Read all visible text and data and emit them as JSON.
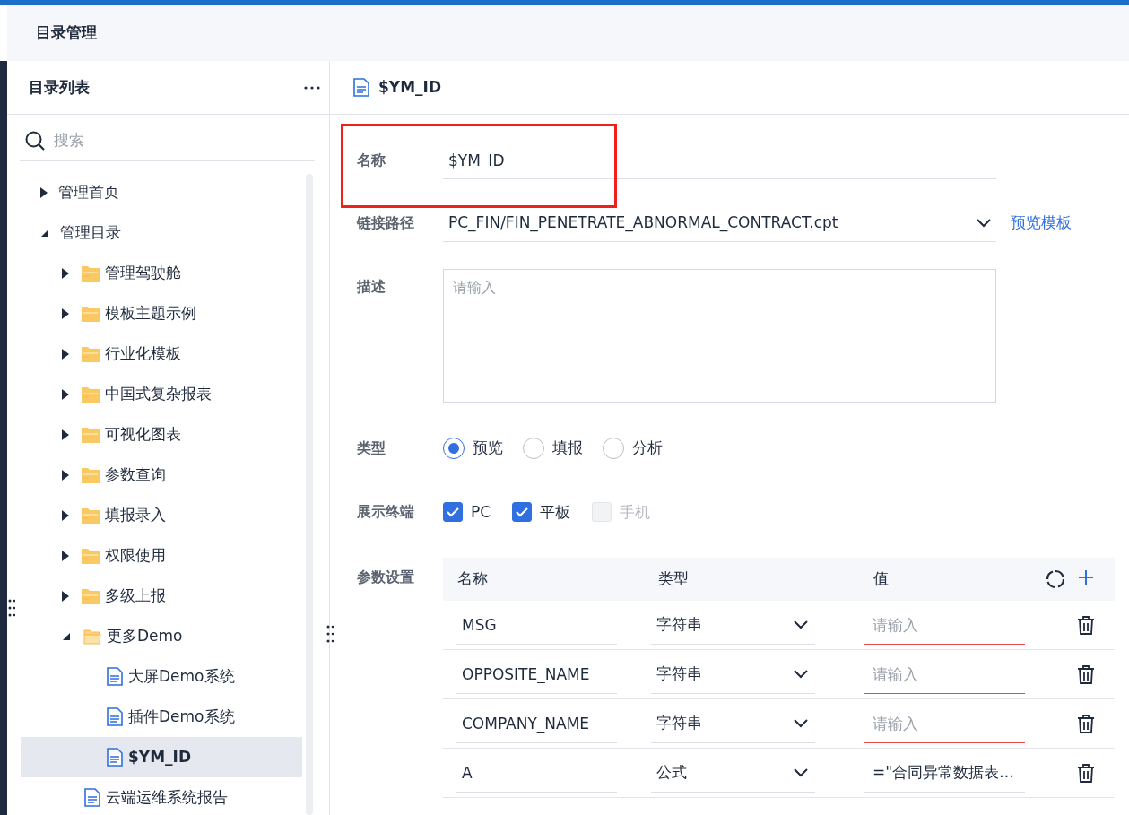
{
  "page_title": "目录管理",
  "catalog": {
    "title": "目录列表",
    "search": {
      "placeholder": "搜索"
    },
    "tree": [
      {
        "label": "管理首页",
        "kind": "root",
        "expanded": false,
        "selected": false
      },
      {
        "label": "管理目录",
        "kind": "root",
        "expanded": true,
        "selected": false,
        "children": [
          {
            "label": "管理驾驶舱",
            "kind": "folder",
            "expanded": false,
            "selected": false
          },
          {
            "label": "模板主题示例",
            "kind": "folder",
            "expanded": false,
            "selected": false
          },
          {
            "label": "行业化模板",
            "kind": "folder",
            "expanded": false,
            "selected": false
          },
          {
            "label": "中国式复杂报表",
            "kind": "folder",
            "expanded": false,
            "selected": false
          },
          {
            "label": "可视化图表",
            "kind": "folder",
            "expanded": false,
            "selected": false
          },
          {
            "label": "参数查询",
            "kind": "folder",
            "expanded": false,
            "selected": false
          },
          {
            "label": "填报录入",
            "kind": "folder",
            "expanded": false,
            "selected": false
          },
          {
            "label": "权限使用",
            "kind": "folder",
            "expanded": false,
            "selected": false
          },
          {
            "label": "多级上报",
            "kind": "folder",
            "expanded": false,
            "selected": false
          },
          {
            "label": "更多Demo",
            "kind": "folder",
            "expanded": true,
            "selected": false,
            "children": [
              {
                "label": "大屏Demo系统",
                "kind": "doc",
                "selected": false
              },
              {
                "label": "插件Demo系统",
                "kind": "doc",
                "selected": false
              },
              {
                "label": "$YM_ID",
                "kind": "doc",
                "selected": true
              }
            ]
          },
          {
            "label": "云端运维系统报告",
            "kind": "doc",
            "selected": false
          }
        ]
      }
    ]
  },
  "detail": {
    "title": "$YM_ID",
    "name": {
      "label": "名称",
      "value": "$YM_ID"
    },
    "path": {
      "label": "链接路径",
      "value": "PC_FIN/FIN_PENETRATE_ABNORMAL_CONTRACT.cpt",
      "link": "预览模板"
    },
    "description": {
      "label": "描述",
      "placeholder": "请输入"
    },
    "type": {
      "label": "类型",
      "options": [
        {
          "label": "预览",
          "selected": true
        },
        {
          "label": "填报",
          "selected": false
        },
        {
          "label": "分析",
          "selected": false
        }
      ]
    },
    "terminals": {
      "label": "展示终端",
      "options": [
        {
          "label": "PC",
          "checked": true,
          "disabled": false
        },
        {
          "label": "平板",
          "checked": true,
          "disabled": false
        },
        {
          "label": "手机",
          "checked": false,
          "disabled": true
        }
      ]
    },
    "params": {
      "label": "参数设置",
      "columns": [
        "名称",
        "类型",
        "值"
      ],
      "rows": [
        {
          "name": "MSG",
          "type": "字符串",
          "value_placeholder": "请输入",
          "invalid": true
        },
        {
          "name": "OPPOSITE_NAME",
          "type": "字符串",
          "value_placeholder": "请输入",
          "invalid": true
        },
        {
          "name": "COMPANY_NAME",
          "type": "字符串",
          "value_placeholder": "请输入",
          "invalid": true
        },
        {
          "name": "A",
          "type": "公式",
          "value": "=\"合同异常数据表…",
          "invalid": false
        }
      ]
    }
  },
  "annotation": {
    "kind": "highlight"
  }
}
